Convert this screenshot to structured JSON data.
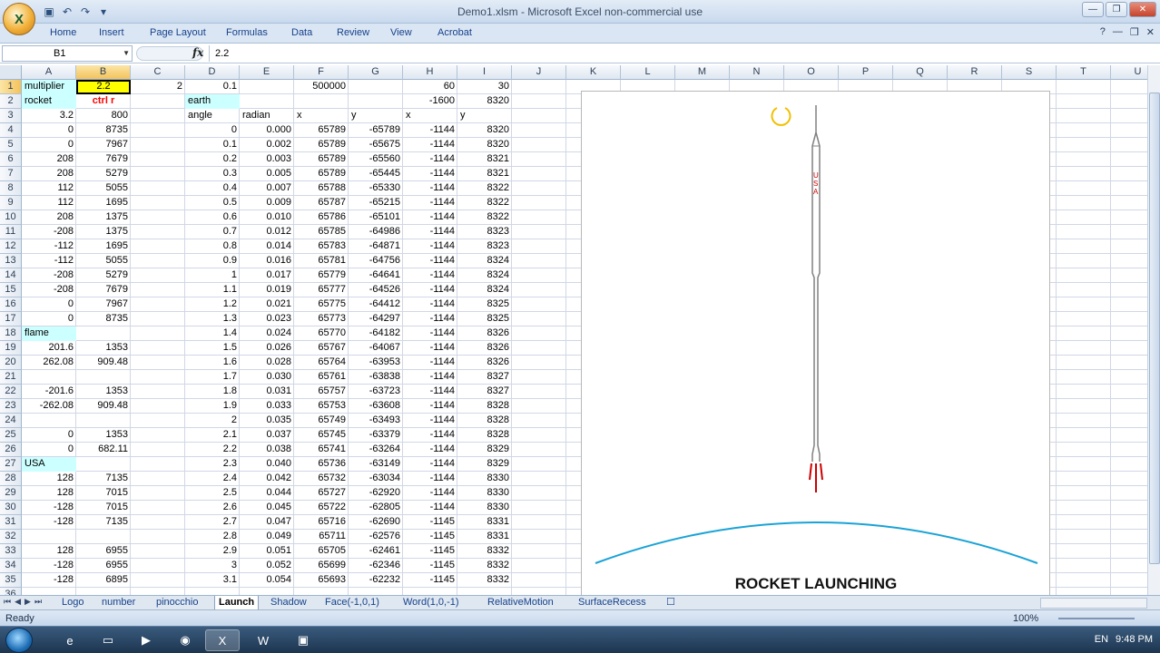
{
  "window": {
    "title": "Demo1.xlsm - Microsoft Excel non-commercial use",
    "office_button_glyph": "X",
    "qat_icons": [
      "save-icon",
      "undo-icon",
      "redo-icon",
      "customize-icon"
    ],
    "qat_glyphs": [
      "▣",
      "↶",
      "↷",
      "▾"
    ],
    "controls": [
      "minimize-icon",
      "restore-icon",
      "close-icon"
    ],
    "control_glyphs": [
      "—",
      "❐",
      "✕"
    ]
  },
  "ribbon": {
    "tabs": [
      "Home",
      "Insert",
      "Page Layout",
      "Formulas",
      "Data",
      "Review",
      "View",
      "Acrobat"
    ],
    "help_glyph": "?",
    "right_glyphs": [
      "—",
      "❐",
      "✕"
    ]
  },
  "formula_bar": {
    "name_box": "B1",
    "fx_label": "fx",
    "formula": "2.2"
  },
  "columns": [
    "A",
    "B",
    "C",
    "D",
    "E",
    "F",
    "G",
    "H",
    "I",
    "J",
    "K",
    "L",
    "M",
    "N",
    "O",
    "P",
    "Q",
    "R",
    "S",
    "T",
    "U"
  ],
  "rows": [
    "1",
    "2",
    "3",
    "4",
    "5",
    "6",
    "7",
    "8",
    "9",
    "10",
    "11",
    "12",
    "13",
    "14",
    "15",
    "16",
    "17",
    "18",
    "19",
    "20",
    "21",
    "22",
    "23",
    "24",
    "25",
    "26",
    "27",
    "28",
    "29",
    "30",
    "31",
    "32",
    "33",
    "34",
    "35",
    "36"
  ],
  "grid": {
    "r1": [
      "multiplier",
      "2.2",
      "2",
      "0.1",
      "",
      "500000",
      "",
      "60",
      "30"
    ],
    "r2": [
      "rocket",
      "ctrl r",
      "",
      "earth",
      "",
      "",
      "",
      "-1600",
      "8320"
    ],
    "r3": [
      "3.2",
      "800",
      "",
      "angle",
      "radian",
      "x",
      "y",
      "x",
      "y"
    ],
    "body": [
      [
        "0",
        "8735",
        "0",
        "0.000",
        "65789",
        "-65789",
        "-1144",
        "8320"
      ],
      [
        "0",
        "7967",
        "0.1",
        "0.002",
        "65789",
        "-65675",
        "-1144",
        "8320"
      ],
      [
        "208",
        "7679",
        "0.2",
        "0.003",
        "65789",
        "-65560",
        "-1144",
        "8321"
      ],
      [
        "208",
        "5279",
        "0.3",
        "0.005",
        "65789",
        "-65445",
        "-1144",
        "8321"
      ],
      [
        "112",
        "5055",
        "0.4",
        "0.007",
        "65788",
        "-65330",
        "-1144",
        "8322"
      ],
      [
        "112",
        "1695",
        "0.5",
        "0.009",
        "65787",
        "-65215",
        "-1144",
        "8322"
      ],
      [
        "208",
        "1375",
        "0.6",
        "0.010",
        "65786",
        "-65101",
        "-1144",
        "8322"
      ],
      [
        "-208",
        "1375",
        "0.7",
        "0.012",
        "65785",
        "-64986",
        "-1144",
        "8323"
      ],
      [
        "-112",
        "1695",
        "0.8",
        "0.014",
        "65783",
        "-64871",
        "-1144",
        "8323"
      ],
      [
        "-112",
        "5055",
        "0.9",
        "0.016",
        "65781",
        "-64756",
        "-1144",
        "8324"
      ],
      [
        "-208",
        "5279",
        "1",
        "0.017",
        "65779",
        "-64641",
        "-1144",
        "8324"
      ],
      [
        "-208",
        "7679",
        "1.1",
        "0.019",
        "65777",
        "-64526",
        "-1144",
        "8324"
      ],
      [
        "0",
        "7967",
        "1.2",
        "0.021",
        "65775",
        "-64412",
        "-1144",
        "8325"
      ],
      [
        "0",
        "8735",
        "1.3",
        "0.023",
        "65773",
        "-64297",
        "-1144",
        "8325"
      ],
      [
        "flame",
        "",
        "1.4",
        "0.024",
        "65770",
        "-64182",
        "-1144",
        "8326"
      ],
      [
        "201.6",
        "1353",
        "1.5",
        "0.026",
        "65767",
        "-64067",
        "-1144",
        "8326"
      ],
      [
        "262.08",
        "909.48",
        "1.6",
        "0.028",
        "65764",
        "-63953",
        "-1144",
        "8326"
      ],
      [
        "",
        "",
        "1.7",
        "0.030",
        "65761",
        "-63838",
        "-1144",
        "8327"
      ],
      [
        "-201.6",
        "1353",
        "1.8",
        "0.031",
        "65757",
        "-63723",
        "-1144",
        "8327"
      ],
      [
        "-262.08",
        "909.48",
        "1.9",
        "0.033",
        "65753",
        "-63608",
        "-1144",
        "8328"
      ],
      [
        "",
        "",
        "2",
        "0.035",
        "65749",
        "-63493",
        "-1144",
        "8328"
      ],
      [
        "0",
        "1353",
        "2.1",
        "0.037",
        "65745",
        "-63379",
        "-1144",
        "8328"
      ],
      [
        "0",
        "682.11",
        "2.2",
        "0.038",
        "65741",
        "-63264",
        "-1144",
        "8329"
      ],
      [
        "USA",
        "",
        "2.3",
        "0.040",
        "65736",
        "-63149",
        "-1144",
        "8329"
      ],
      [
        "128",
        "7135",
        "2.4",
        "0.042",
        "65732",
        "-63034",
        "-1144",
        "8330"
      ],
      [
        "128",
        "7015",
        "2.5",
        "0.044",
        "65727",
        "-62920",
        "-1144",
        "8330"
      ],
      [
        "-128",
        "7015",
        "2.6",
        "0.045",
        "65722",
        "-62805",
        "-1144",
        "8330"
      ],
      [
        "-128",
        "7135",
        "2.7",
        "0.047",
        "65716",
        "-62690",
        "-1145",
        "8331"
      ],
      [
        "",
        "",
        "2.8",
        "0.049",
        "65711",
        "-62576",
        "-1145",
        "8331"
      ],
      [
        "128",
        "6955",
        "2.9",
        "0.051",
        "65705",
        "-62461",
        "-1145",
        "8332"
      ],
      [
        "-128",
        "6955",
        "3",
        "0.052",
        "65699",
        "-62346",
        "-1145",
        "8332"
      ],
      [
        "-128",
        "6895",
        "3.1",
        "0.054",
        "65693",
        "-62232",
        "-1145",
        "8332"
      ]
    ]
  },
  "chart": {
    "title": "ROCKET LAUNCHING",
    "rocket_label": "USA"
  },
  "sheet_tabs": [
    "Logo",
    "number",
    "pinocchio",
    "Launch",
    "Shadow",
    "Face(-1,0,1)",
    "Word(1,0,-1)",
    "RelativeMotion",
    "SurfaceRecess"
  ],
  "active_sheet": "Launch",
  "sheet_nav_glyphs": [
    "⏮",
    "◀",
    "▶",
    "⏭"
  ],
  "status": {
    "ready": "Ready",
    "zoom": "100%"
  },
  "taskbar": {
    "items": [
      "ie-icon",
      "explorer-icon",
      "media-player-icon",
      "firefox-icon",
      "excel-icon",
      "word-icon",
      "vba-icon"
    ],
    "item_glyphs": [
      "e",
      "▭",
      "▶",
      "◉",
      "X",
      "W",
      "▣"
    ],
    "lang": "EN",
    "clock": "9:48 PM"
  },
  "colors": {
    "selected_cell": "#ffff00",
    "label_highlight": "#ccffff",
    "ctrl_r": "#ff0000",
    "earth": "#1aa3d6",
    "flame": "#cc0000",
    "rocket": "#808080",
    "moon": "#f0c000"
  }
}
